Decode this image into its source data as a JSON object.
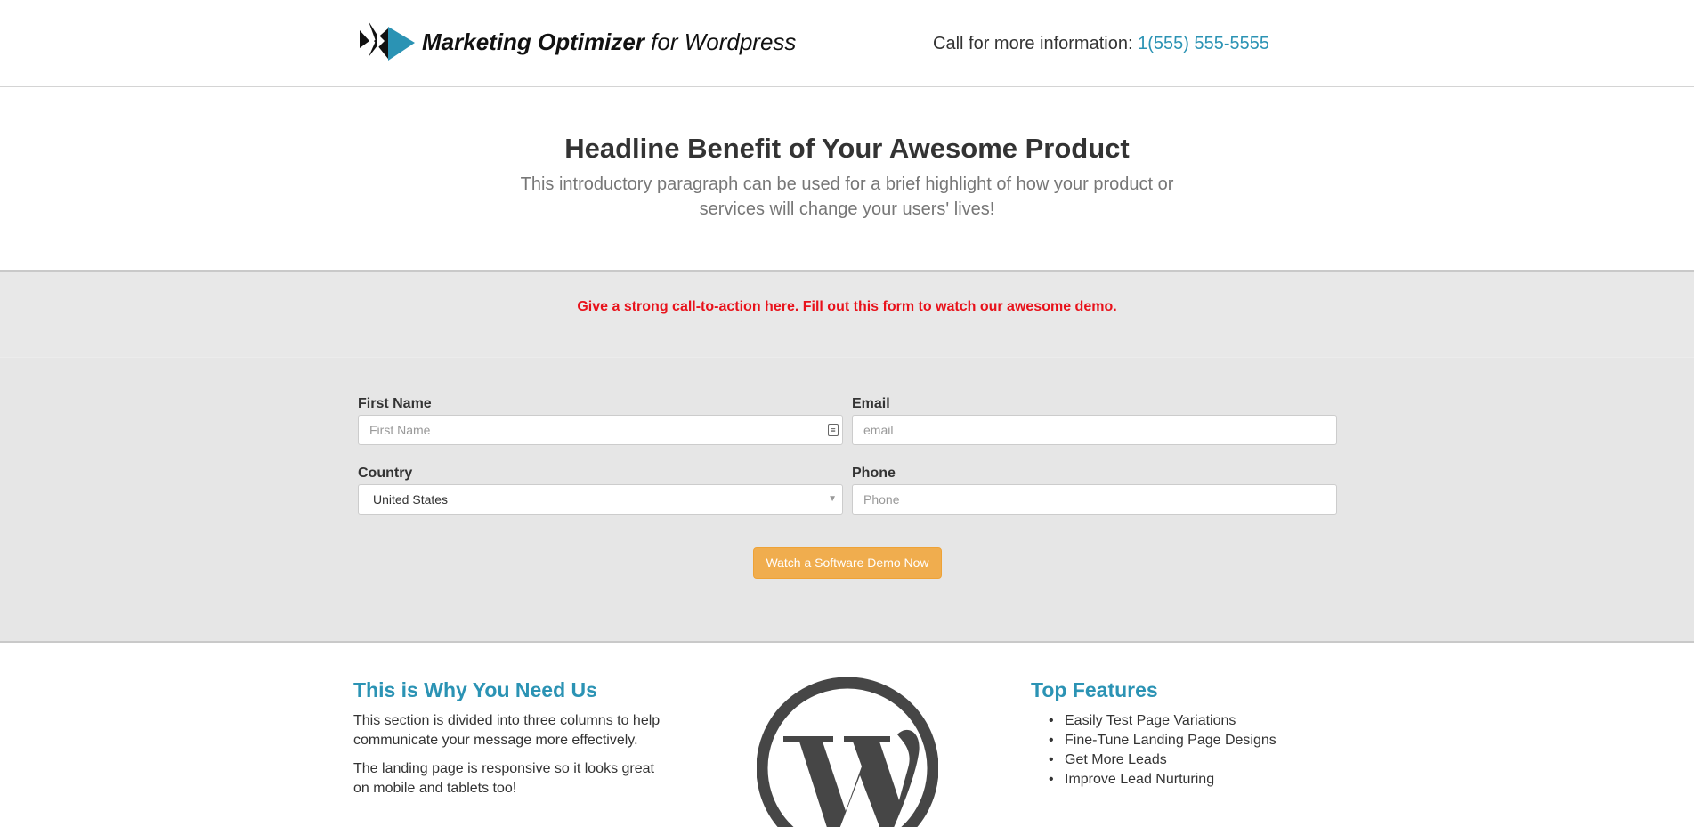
{
  "header": {
    "logo_bold": "Marketing Optimizer",
    "logo_rest": " for Wordpress",
    "call_prefix": "Call for more information: ",
    "phone": "1(555) 555-5555"
  },
  "hero": {
    "headline": "Headline Benefit of Your Awesome Product",
    "intro": "This introductory paragraph can be used for a brief highlight of how your product or services will change your users' lives!"
  },
  "form": {
    "cta": "Give a strong call-to-action here. Fill out this form to watch our awesome demo.",
    "first_name_label": "First Name",
    "first_name_placeholder": "First Name",
    "email_label": "Email",
    "email_placeholder": "email",
    "country_label": "Country",
    "country_value": "United States",
    "phone_label": "Phone",
    "phone_placeholder": "Phone",
    "submit_label": "Watch a Software Demo Now"
  },
  "columns": {
    "left_title": "This is Why You Need Us",
    "left_p1": "This section is divided into three columns to help communicate your message more effectively.",
    "left_p2": "The landing page is responsive so it looks great on mobile and tablets too!",
    "right_title": "Top Features",
    "features": [
      "Easily Test Page Variations",
      "Fine-Tune Landing Page Designs",
      "Get More Leads",
      "Improve Lead Nurturing"
    ]
  },
  "colors": {
    "accent": "#2b93b4",
    "cta_red": "#e8121b",
    "button": "#f0ad4e",
    "band": "#e6e6e6"
  },
  "icons": {
    "logo_mark": "play-arrows-logo-icon",
    "wordpress": "wordpress-logo-icon",
    "contact_card": "contact-card-icon",
    "dropdown": "caret-down-icon"
  }
}
